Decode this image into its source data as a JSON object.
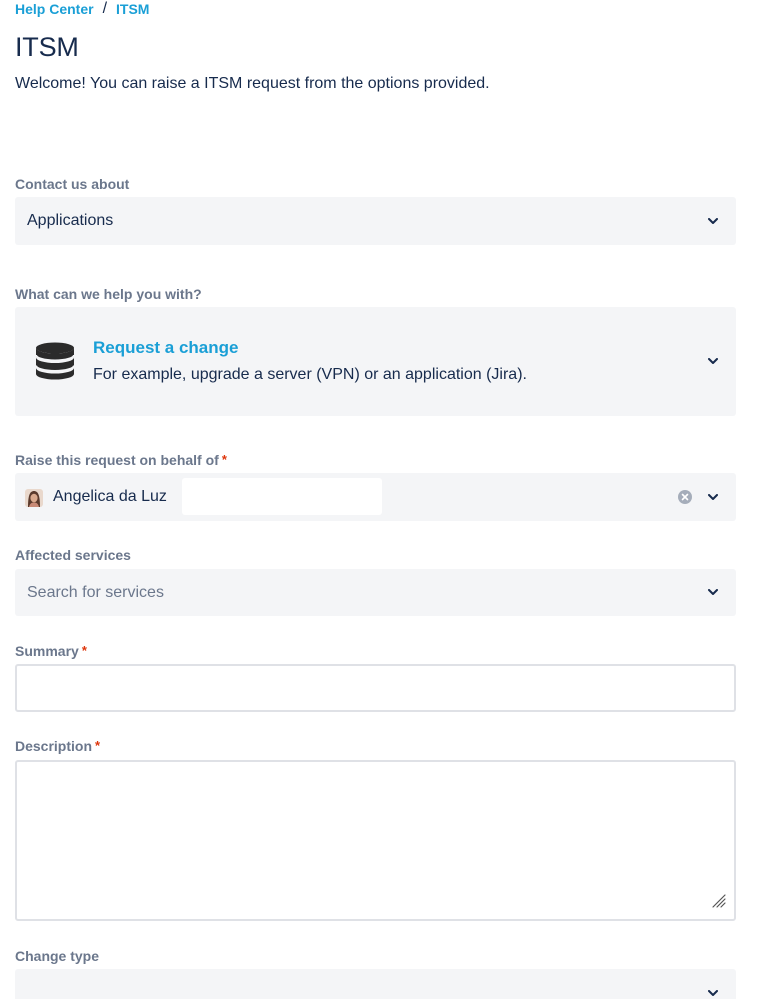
{
  "breadcrumb": {
    "home": "Help Center",
    "separator": "/",
    "current": "ITSM"
  },
  "page": {
    "title": "ITSM",
    "intro": "Welcome! You can raise a ITSM request from the options provided."
  },
  "contact": {
    "label": "Contact us about",
    "value": "Applications"
  },
  "help": {
    "label": "What can we help you with?",
    "request_title": "Request a change",
    "request_desc": "For example, upgrade a server (VPN) or an application (Jira).",
    "icon": "database-icon"
  },
  "behalf": {
    "label": "Raise this request on behalf of",
    "required": "*",
    "value": "Angelica da Luz"
  },
  "services": {
    "label": "Affected services",
    "placeholder": "Search for services"
  },
  "summary": {
    "label": "Summary",
    "required": "*",
    "value": ""
  },
  "description": {
    "label": "Description",
    "required": "*",
    "value": ""
  },
  "change_type": {
    "label": "Change type",
    "value": ""
  },
  "colors": {
    "link": "#1a9fd6",
    "text": "#172b4d",
    "label": "#6b778c",
    "required": "#de350b",
    "field_bg": "#f4f5f7"
  }
}
